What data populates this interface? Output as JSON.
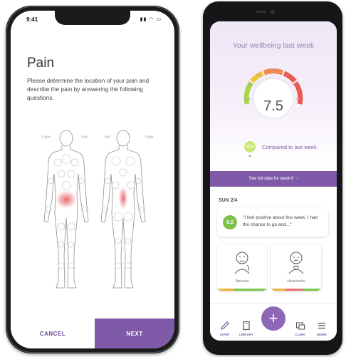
{
  "pain_screen": {
    "status_time": "9:41",
    "title": "Pain",
    "description": "Please determine the location of your pain and describe the pain by answering the following questions.",
    "front_labels": {
      "left": "Right",
      "right": "Left"
    },
    "back_labels": {
      "left": "Left",
      "right": "Right"
    },
    "cancel_label": "CANCEL",
    "next_label": "NEXT"
  },
  "wellbeing_screen": {
    "title": "Your wellbeing last week",
    "score": "7.5",
    "delta": "+0.4",
    "compare_text": "Compared to last week",
    "full_data_link": "See full data for week 6",
    "day_label": "SUN 2/4",
    "diary_score": "9.2",
    "diary_text": "\"I feel positive about this week. I had the chance to go and...\"",
    "symptoms": [
      {
        "label": "Nausea",
        "strip_colors": [
          "#f2b233",
          "#7cc24a",
          "#7cc24a"
        ]
      },
      {
        "label": "Heartache",
        "strip_colors": [
          "#f2b233",
          "#e57373",
          "#7cc24a"
        ]
      }
    ],
    "nav": [
      {
        "label": "DIARY",
        "icon": "pencil-icon"
      },
      {
        "label": "LIBRARY",
        "icon": "book-icon"
      },
      {
        "label": "CLINIC",
        "icon": "clinic-icon"
      },
      {
        "label": "MORE",
        "icon": "menu-icon"
      }
    ],
    "add_symbol": "+",
    "colors": {
      "accent": "#7e5aa8",
      "good": "#7cc24a",
      "warn": "#f2b233",
      "bad": "#e57373"
    }
  }
}
